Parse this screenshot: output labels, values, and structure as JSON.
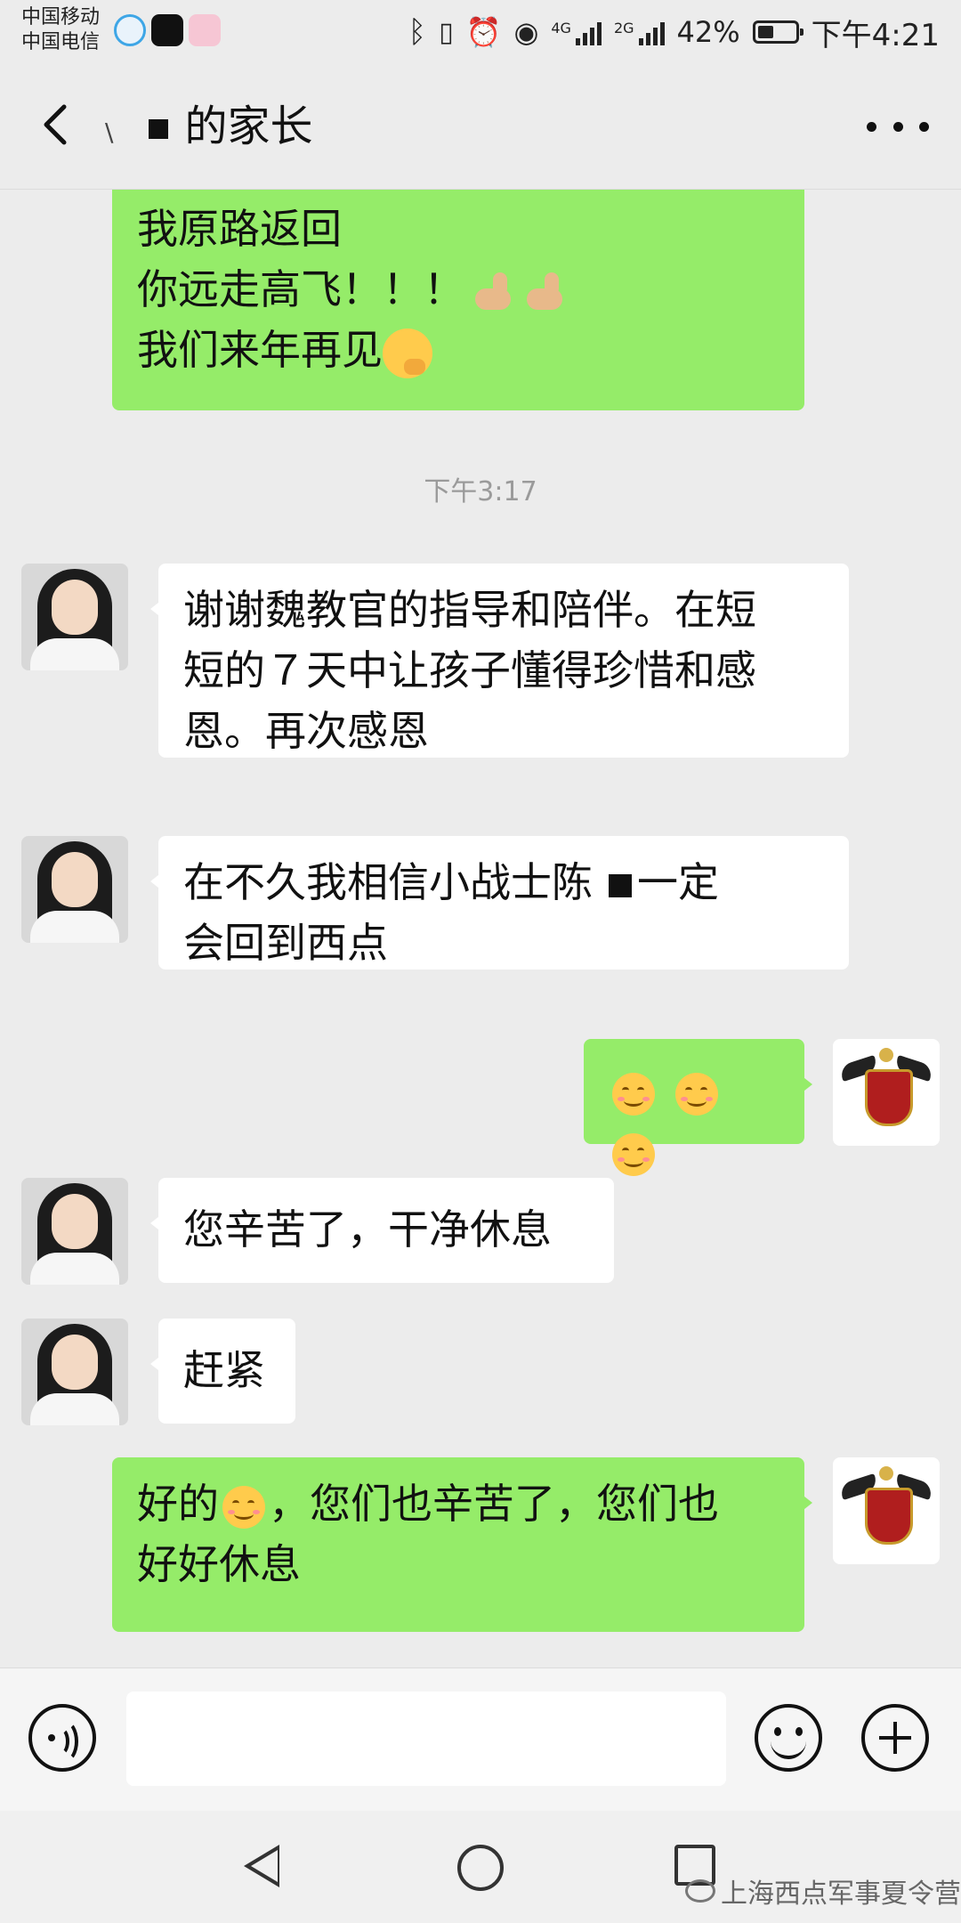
{
  "status_bar": {
    "carrier_1": "中国移动",
    "carrier_2": "中国电信",
    "net_1": "4G",
    "net_2": "2G",
    "battery": "42%",
    "battery_level": 0.42,
    "time": "下午4:21"
  },
  "header": {
    "title_prefix": "\\",
    "title_suffix": "的家长"
  },
  "messages": {
    "m1": {
      "line1": "我原路返回",
      "line2": "你远走高飞！！！",
      "line3": "我们来年再见"
    },
    "timestamp": "下午3:17",
    "m2": {
      "line1": "谢谢魏教官的指导和陪伴。在短",
      "line2": "短的７天中让孩子懂得珍惜和感",
      "line3": "恩。再次感恩"
    },
    "m3": {
      "line1": "在不久我相信小战士陈",
      "line1_end": "一定",
      "line2": "会回到西点"
    },
    "m5": {
      "text": "您辛苦了，干净休息"
    },
    "m6": {
      "text": "赶紧"
    },
    "m7": {
      "line1_a": "好的",
      "line1_b": "，您们也辛苦了，您们也",
      "line2": "好好休息"
    }
  },
  "input": {
    "placeholder": ""
  },
  "watermark": {
    "text": "上海西点军事夏令营"
  },
  "colors": {
    "background": "#ececec",
    "sent_bubble": "#95ec69",
    "received_bubble": "#ffffff",
    "timestamp": "#9a9a9a"
  },
  "icons": [
    "back-arrow-icon",
    "more-icon",
    "voice-icon",
    "emoji-icon",
    "plus-icon",
    "nav-back-icon",
    "nav-home-icon",
    "nav-recent-icon"
  ]
}
